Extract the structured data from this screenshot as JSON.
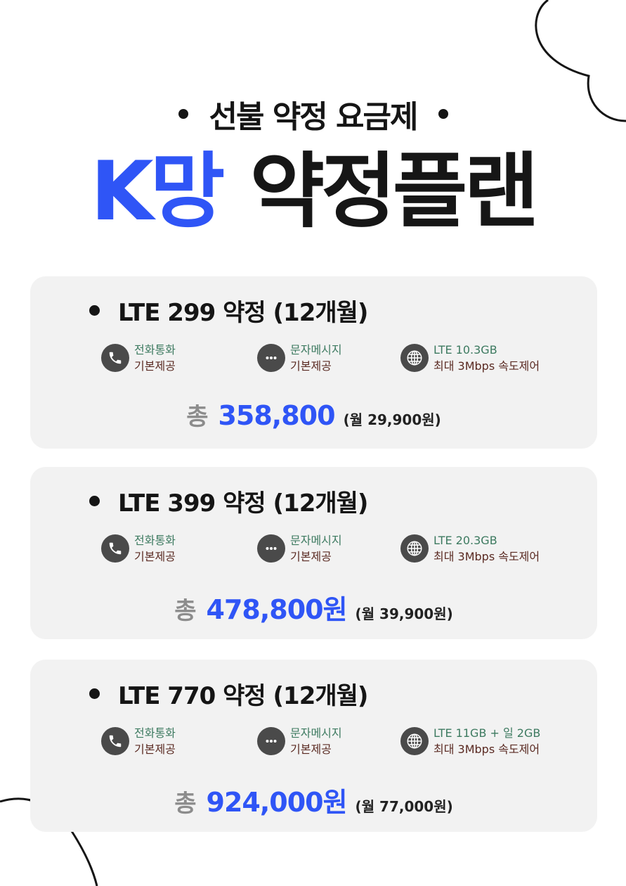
{
  "header": {
    "subtitle": "선불 약정 요금제",
    "title_accent": "K망",
    "title_main": "약정플랜"
  },
  "colors": {
    "accent": "#2f55f6",
    "card_bg": "#f2f2f2",
    "text_dark": "#151515",
    "feature_line1": "#3d7a60",
    "feature_line2": "#5a2a22"
  },
  "plans": [
    {
      "name": "LTE 299 약정 (12개월)",
      "features": [
        {
          "icon": "phone-icon",
          "line1": "전화통화",
          "line2": "기본제공"
        },
        {
          "icon": "message-icon",
          "line1": "문자메시지",
          "line2": "기본제공"
        },
        {
          "icon": "globe-icon",
          "line1": "LTE 10.3GB",
          "line2": "최대 3Mbps 속도제어"
        }
      ],
      "price_label": "총",
      "price_total": "358,800",
      "price_monthly": "(월  29,900원)"
    },
    {
      "name": "LTE 399 약정 (12개월)",
      "features": [
        {
          "icon": "phone-icon",
          "line1": "전화통화",
          "line2": "기본제공"
        },
        {
          "icon": "message-icon",
          "line1": "문자메시지",
          "line2": "기본제공"
        },
        {
          "icon": "globe-icon",
          "line1": "LTE 20.3GB",
          "line2": "최대 3Mbps 속도제어"
        }
      ],
      "price_label": "총",
      "price_total": "478,800원",
      "price_monthly": "(월 39,900원)"
    },
    {
      "name": "LTE 770 약정 (12개월)",
      "features": [
        {
          "icon": "phone-icon",
          "line1": "전화통화",
          "line2": "기본제공"
        },
        {
          "icon": "message-icon",
          "line1": "문자메시지",
          "line2": "기본제공"
        },
        {
          "icon": "globe-icon",
          "line1": "LTE 11GB + 일 2GB",
          "line2": "최대 3Mbps 속도제어"
        }
      ],
      "price_label": "총",
      "price_total": "924,000원",
      "price_monthly": "(월 77,000원)"
    }
  ]
}
